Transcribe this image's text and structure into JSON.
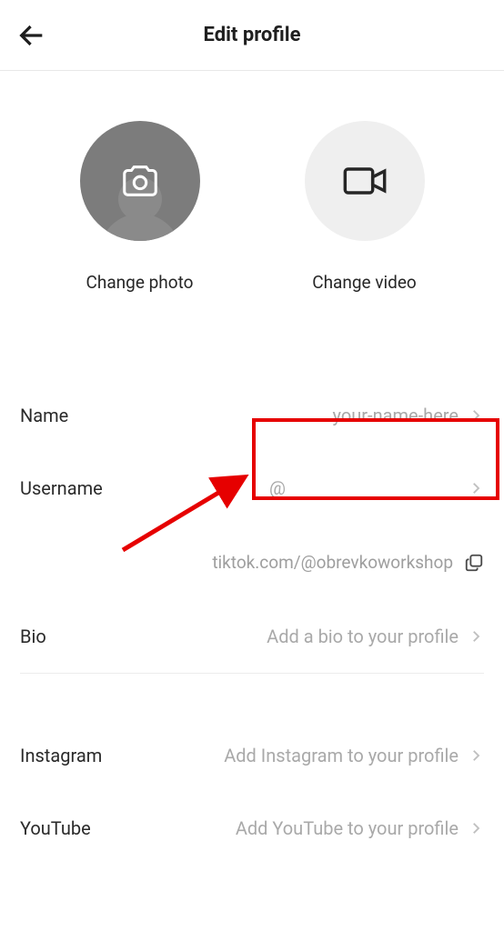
{
  "header": {
    "title": "Edit profile"
  },
  "media": {
    "photo_label": "Change photo",
    "video_label": "Change video"
  },
  "fields": {
    "name_label": "Name",
    "name_value": "your-name-here",
    "username_label": "Username",
    "username_value": "@",
    "bio_label": "Bio",
    "bio_value": "Add a bio to your profile"
  },
  "profile_url": "tiktok.com/@obrevkoworkshop",
  "social": {
    "instagram_label": "Instagram",
    "instagram_value": "Add Instagram to your profile",
    "youtube_label": "YouTube",
    "youtube_value": "Add YouTube to your profile"
  }
}
